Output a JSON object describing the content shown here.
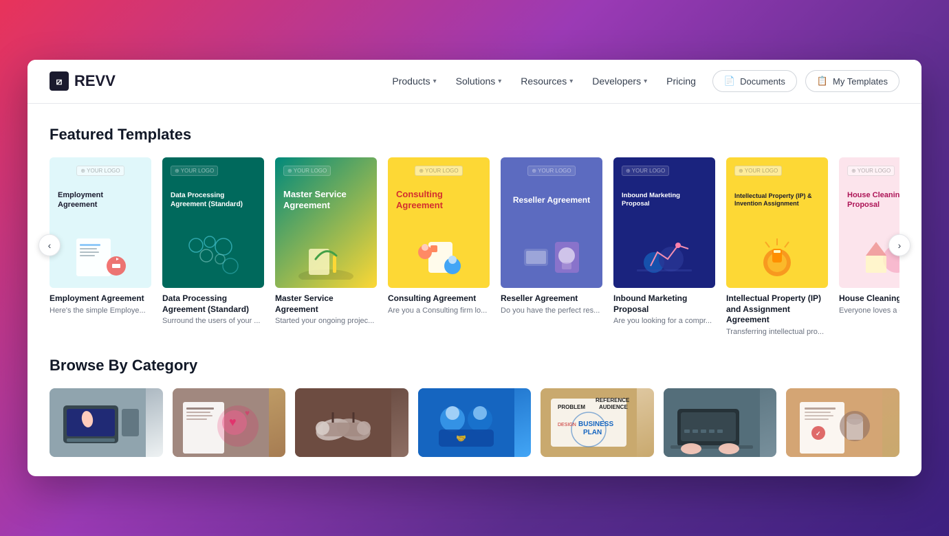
{
  "brand": {
    "name": "REVV",
    "logo_icon": "⧄"
  },
  "nav": {
    "links": [
      {
        "label": "Products",
        "has_dropdown": true
      },
      {
        "label": "Solutions",
        "has_dropdown": true
      },
      {
        "label": "Resources",
        "has_dropdown": true
      },
      {
        "label": "Developers",
        "has_dropdown": true
      },
      {
        "label": "Pricing",
        "has_dropdown": false
      }
    ],
    "buttons": [
      {
        "label": "Documents",
        "icon": "📄"
      },
      {
        "label": "My Templates",
        "icon": "📋"
      }
    ]
  },
  "featured": {
    "title": "Featured Templates",
    "templates": [
      {
        "id": "employment",
        "name": "Employment Agreement",
        "desc": "Here's the simple Employe...",
        "logo_text": "YOUR LOGO",
        "title_text": "Employment Agreement",
        "theme": "light"
      },
      {
        "id": "dataproc",
        "name": "Data Processing Agreement (Standard)",
        "desc": "Surround the users of your ...",
        "logo_text": "YOUR LOGO",
        "title_text": "Data Processing Agreement (Standard)",
        "theme": "dark-teal"
      },
      {
        "id": "msa",
        "name": "Master Service Agreement",
        "desc": "Started your ongoing projec...",
        "logo_text": "YOUR LOGO",
        "title_text": "Master Service Agreement",
        "theme": "teal-yellow"
      },
      {
        "id": "consulting",
        "name": "Consulting Agreement",
        "desc": "Are you a Consulting firm lo...",
        "logo_text": "YOUR LOGO",
        "title_text": "Consulting Agreement",
        "theme": "yellow"
      },
      {
        "id": "reseller",
        "name": "Reseller Agreement",
        "desc": "Do you have the perfect res...",
        "logo_text": "YOUR LOGO",
        "title_text": "Reseller Agreement",
        "theme": "purple"
      },
      {
        "id": "inbound",
        "name": "Inbound Marketing Proposal",
        "desc": "Are you looking for a compr...",
        "logo_text": "YOUR LOGO",
        "title_text": "Inbound Marketing Proposal",
        "theme": "dark-blue"
      },
      {
        "id": "ip",
        "name": "Intellectual Property (IP) and Assignment Agreement",
        "desc": "Transferring intellectual pro...",
        "logo_text": "YOUR LOGO",
        "title_text": "Intellectual Property (IP) & Invention Assignment",
        "theme": "yellow-dark"
      },
      {
        "id": "houseclean",
        "name": "House Cleaning Proposal",
        "desc": "Everyone loves a clean hou...",
        "logo_text": "YOUR LOGO",
        "title_text": "House Cleaning Proposal",
        "theme": "pink"
      }
    ]
  },
  "browse": {
    "title": "Browse By Category",
    "categories": [
      {
        "id": "cat1",
        "icon": "⌨️",
        "theme": "cat-1-bg"
      },
      {
        "id": "cat2",
        "icon": "📃",
        "theme": "cat-2-bg"
      },
      {
        "id": "cat3",
        "icon": "🤝",
        "theme": "cat-3-bg"
      },
      {
        "id": "cat4",
        "icon": "🤝",
        "theme": "cat-4-bg"
      },
      {
        "id": "cat5",
        "icon": "📊",
        "theme": "cat-5-bg"
      },
      {
        "id": "cat6",
        "icon": "💻",
        "theme": "cat-6-bg"
      },
      {
        "id": "cat7",
        "icon": "🖊️",
        "theme": "cat-7-bg"
      }
    ]
  },
  "carousel": {
    "prev_label": "‹",
    "next_label": "›"
  }
}
